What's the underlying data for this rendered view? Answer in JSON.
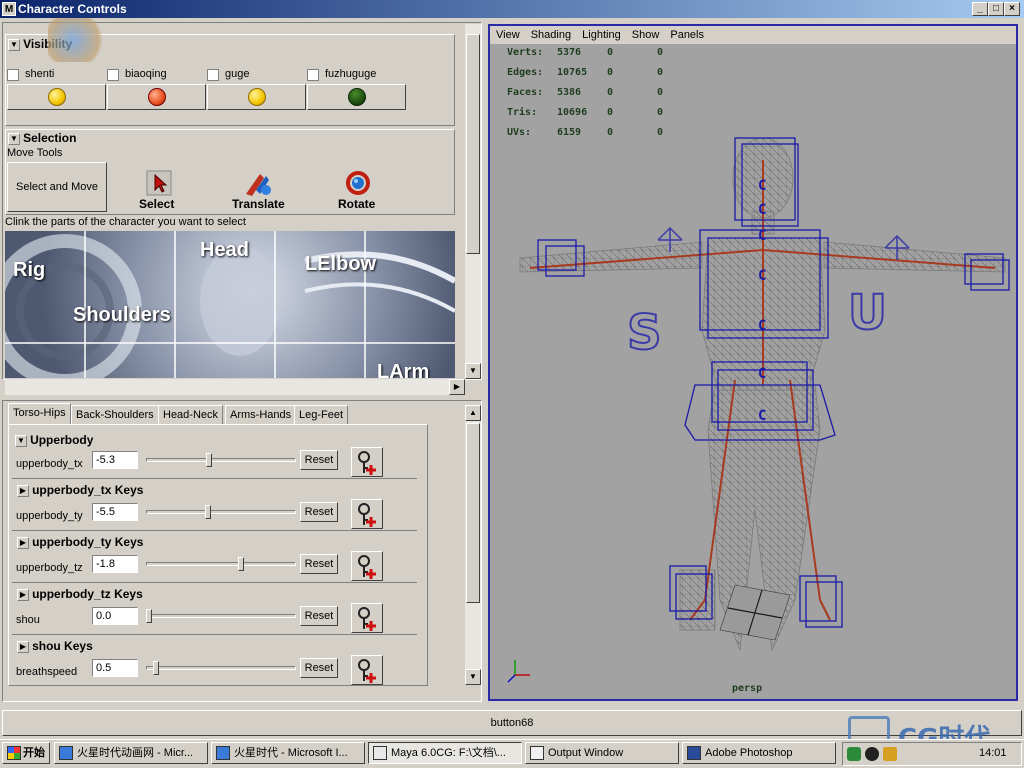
{
  "window": {
    "title": "Character Controls",
    "minimize": "_",
    "maximize": "□",
    "close": "×"
  },
  "visibility": {
    "header": "Visibility",
    "items": [
      {
        "label": "shenti"
      },
      {
        "label": "biaoqing"
      },
      {
        "label": "guge"
      },
      {
        "label": "fuzhuguge"
      }
    ]
  },
  "selection": {
    "header": "Selection",
    "move_tools_label": "Move Tools",
    "select_and_move": "Select and Move",
    "tools": [
      {
        "label": "Select"
      },
      {
        "label": "Translate"
      },
      {
        "label": "Rotate"
      }
    ],
    "instruction": "Clink the parts of the character you want to select",
    "image_labels": [
      "Rig",
      "Head",
      "LElbow",
      "Shoulders",
      "LArm"
    ]
  },
  "tabs": [
    "Torso-Hips",
    "Back-Shoulders",
    "Head-Neck",
    "Arms-Hands",
    "Leg-Feet"
  ],
  "active_tab": "Torso-Hips",
  "upperbody": {
    "header": "Upperbody",
    "reset_label": "Reset",
    "rows": [
      {
        "label": "upperbody_tx",
        "value": "-5.3",
        "slider": 0.42,
        "keys": "upperbody_tx Keys"
      },
      {
        "label": "upperbody_ty",
        "value": "-5.5",
        "slider": 0.41,
        "keys": "upperbody_ty Keys"
      },
      {
        "label": "upperbody_tz",
        "value": "-1.8",
        "slider": 0.64,
        "keys": "upperbody_tz Keys"
      },
      {
        "label": "shou",
        "value": "0.0",
        "slider": 0.0,
        "keys": "shou Keys"
      },
      {
        "label": "breathspeed",
        "value": "0.5",
        "slider": 0.05,
        "keys": ""
      }
    ]
  },
  "viewport": {
    "menu": [
      "View",
      "Shading",
      "Lighting",
      "Show",
      "Panels"
    ],
    "stats": [
      {
        "label": "Verts:",
        "a": "5376",
        "b": "0",
        "c": "0"
      },
      {
        "label": "Edges:",
        "a": "10765",
        "b": "0",
        "c": "0"
      },
      {
        "label": "Faces:",
        "a": "5386",
        "b": "0",
        "c": "0"
      },
      {
        "label": "Tris:",
        "a": "10696",
        "b": "0",
        "c": "0"
      },
      {
        "label": "UVs:",
        "a": "6159",
        "b": "0",
        "c": "0"
      }
    ],
    "camera": "persp",
    "letters": [
      "S",
      "U"
    ]
  },
  "status": {
    "button_label": "button68",
    "watermark": "CG时代"
  },
  "taskbar": {
    "start": "开始",
    "tasks": [
      {
        "label": "火星时代动画网 - Micr..."
      },
      {
        "label": "火星时代 - Microsoft I..."
      },
      {
        "label": "Maya 6.0CG: F:\\文档\\..."
      },
      {
        "label": "Output Window"
      },
      {
        "label": "Adobe Photoshop"
      }
    ],
    "clock": "14:01"
  }
}
